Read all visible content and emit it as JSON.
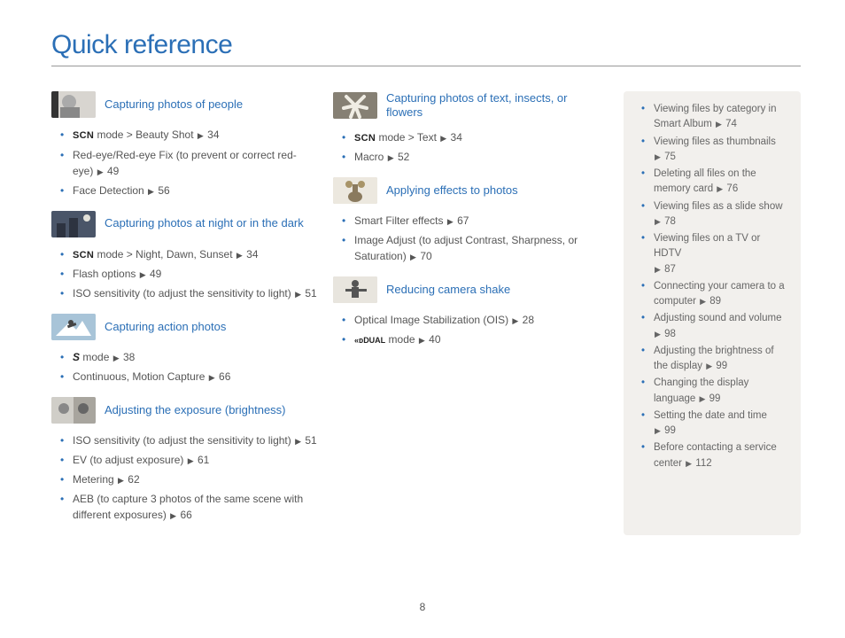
{
  "title": "Quick reference",
  "page_number": "8",
  "arrow": "▶",
  "icons": {
    "scn": "SCN",
    "s": "S",
    "dual": "DUAL"
  },
  "left": {
    "s1": {
      "title": "Capturing photos of people",
      "i1a": " mode > Beauty Shot ",
      "i1p": "34",
      "i2a": "Red-eye/Red-eye Fix (to prevent or correct red-eye) ",
      "i2p": "49",
      "i3a": "Face Detection ",
      "i3p": "56"
    },
    "s2": {
      "title": "Capturing photos at night or in the dark",
      "i1a": " mode > Night, Dawn, Sunset ",
      "i1p": "34",
      "i2a": "Flash options ",
      "i2p": "49",
      "i3a": "ISO sensitivity (to adjust the sensitivity to light) ",
      "i3p": "51"
    },
    "s3": {
      "title": "Capturing action photos",
      "i1a": " mode ",
      "i1p": "38",
      "i2a": "Continuous, Motion Capture ",
      "i2p": "66"
    },
    "s4": {
      "title": "Adjusting the exposure (brightness)",
      "i1a": "ISO sensitivity (to adjust the sensitivity to light) ",
      "i1p": "51",
      "i2a": "EV (to adjust exposure) ",
      "i2p": "61",
      "i3a": "Metering ",
      "i3p": "62",
      "i4a": "AEB (to capture 3 photos of the same scene with different exposures) ",
      "i4p": "66"
    }
  },
  "mid": {
    "s1": {
      "title": "Capturing photos of text, insects, or flowers",
      "i1a": " mode > Text ",
      "i1p": "34",
      "i2a": "Macro ",
      "i2p": "52"
    },
    "s2": {
      "title": "Applying effects to photos",
      "i1a": "Smart Filter effects ",
      "i1p": "67",
      "i2a": "Image Adjust (to adjust Contrast, Sharpness, or Saturation) ",
      "i2p": "70"
    },
    "s3": {
      "title": "Reducing camera shake",
      "i1a": "Optical Image Stabilization (OIS) ",
      "i1p": "28",
      "i2a": " mode ",
      "i2p": "40"
    }
  },
  "right": {
    "i1a": "Viewing files by category in Smart Album ",
    "i1p": "74",
    "i2a": "Viewing files as thumbnails ",
    "i2p": "75",
    "i3a": "Deleting all files on the memory card ",
    "i3p": "76",
    "i4a": "Viewing files as a slide show ",
    "i4p": "78",
    "i5a": "Viewing files on a TV or HDTV ",
    "i5p": "87",
    "i6a": "Connecting your camera to a computer ",
    "i6p": "89",
    "i7a": "Adjusting sound and volume ",
    "i7p": "98",
    "i8a": "Adjusting the brightness of the display ",
    "i8p": "99",
    "i9a": "Changing the display language ",
    "i9p": "99",
    "i10a": "Setting the date and time ",
    "i10p": "99",
    "i11a": "Before contacting a service center ",
    "i11p": "112"
  }
}
